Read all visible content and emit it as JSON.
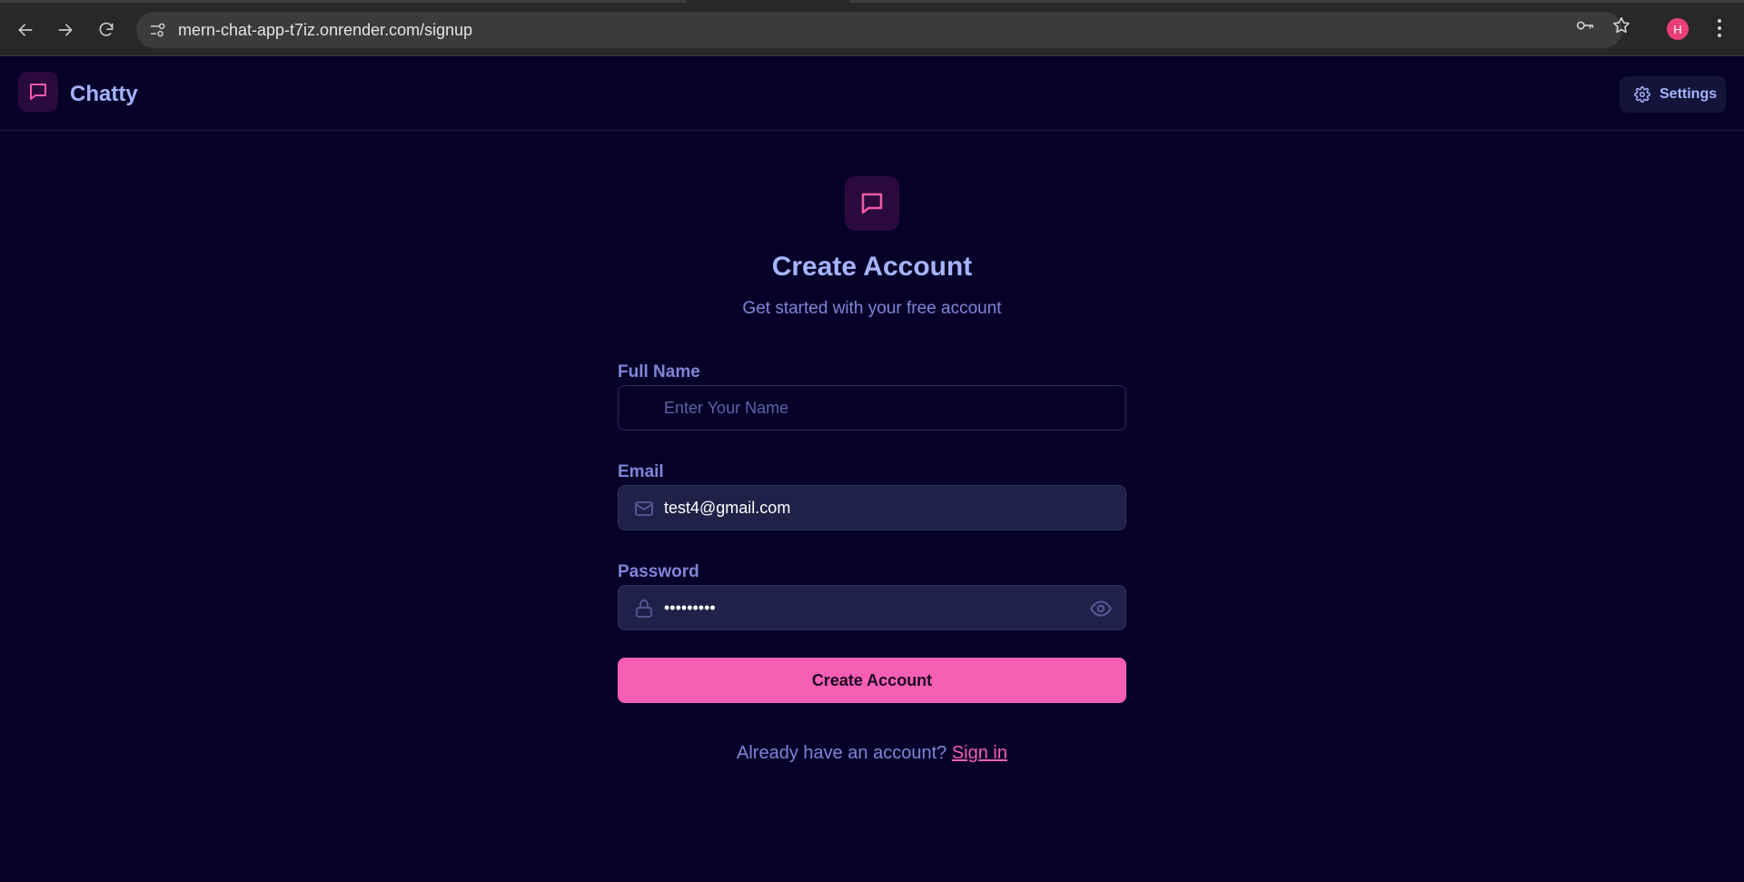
{
  "browser": {
    "url": "mern-chat-app-t7iz.onrender.com/signup",
    "profile_initial": "H",
    "profile_color": "#ea3f78"
  },
  "header": {
    "brand": "Chatty",
    "settings_label": "Settings"
  },
  "form": {
    "title": "Create Account",
    "subtitle": "Get started with your free account",
    "full_name": {
      "label": "Full Name",
      "placeholder": "Enter Your Name",
      "value": ""
    },
    "email": {
      "label": "Email",
      "value": "test4@gmail.com"
    },
    "password": {
      "label": "Password",
      "value": "•••••••••"
    },
    "submit_label": "Create Account",
    "signin_prompt": "Already have an account?",
    "signin_link": "Sign in"
  },
  "colors": {
    "background": "#07012a",
    "accent": "#f65fb4",
    "primary_text": "#a5b4fc",
    "muted_text": "#7f86d6"
  },
  "icons": [
    "back-icon",
    "forward-icon",
    "reload-icon",
    "site-settings-icon",
    "password-key-icon",
    "bookmark-star-icon",
    "menu-dots-icon",
    "chat-bubble-icon",
    "gear-icon",
    "mail-icon",
    "lock-icon",
    "eye-icon"
  ]
}
